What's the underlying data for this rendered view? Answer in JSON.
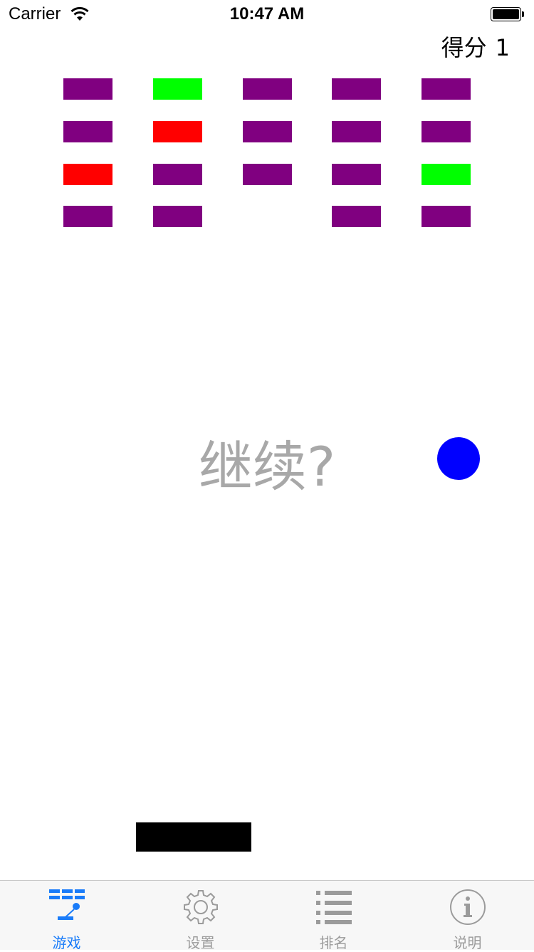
{
  "status_bar": {
    "carrier": "Carrier",
    "time": "10:47 AM"
  },
  "hud": {
    "score_label": "得分",
    "score_value": "1"
  },
  "colors": {
    "purple": "#800080",
    "green": "#00ff00",
    "red": "#ff0000",
    "ball": "#0000ff",
    "paddle": "#000000",
    "tab_active": "#1a7cf9",
    "tab_inactive": "#9b9b9b"
  },
  "bricks": [
    [
      "purple",
      "green",
      "purple",
      "purple",
      "purple"
    ],
    [
      "purple",
      "red",
      "purple",
      "purple",
      "purple"
    ],
    [
      "red",
      "purple",
      "purple",
      "purple",
      "green"
    ],
    [
      "purple",
      "purple",
      null,
      "purple",
      "purple"
    ]
  ],
  "overlay": {
    "continue_prompt": "继续?"
  },
  "tab_bar": {
    "tabs": [
      {
        "label": "游戏",
        "icon": "game-icon",
        "active": true
      },
      {
        "label": "设置",
        "icon": "gear-icon",
        "active": false
      },
      {
        "label": "排名",
        "icon": "list-icon",
        "active": false
      },
      {
        "label": "说明",
        "icon": "info-icon",
        "active": false
      }
    ]
  }
}
